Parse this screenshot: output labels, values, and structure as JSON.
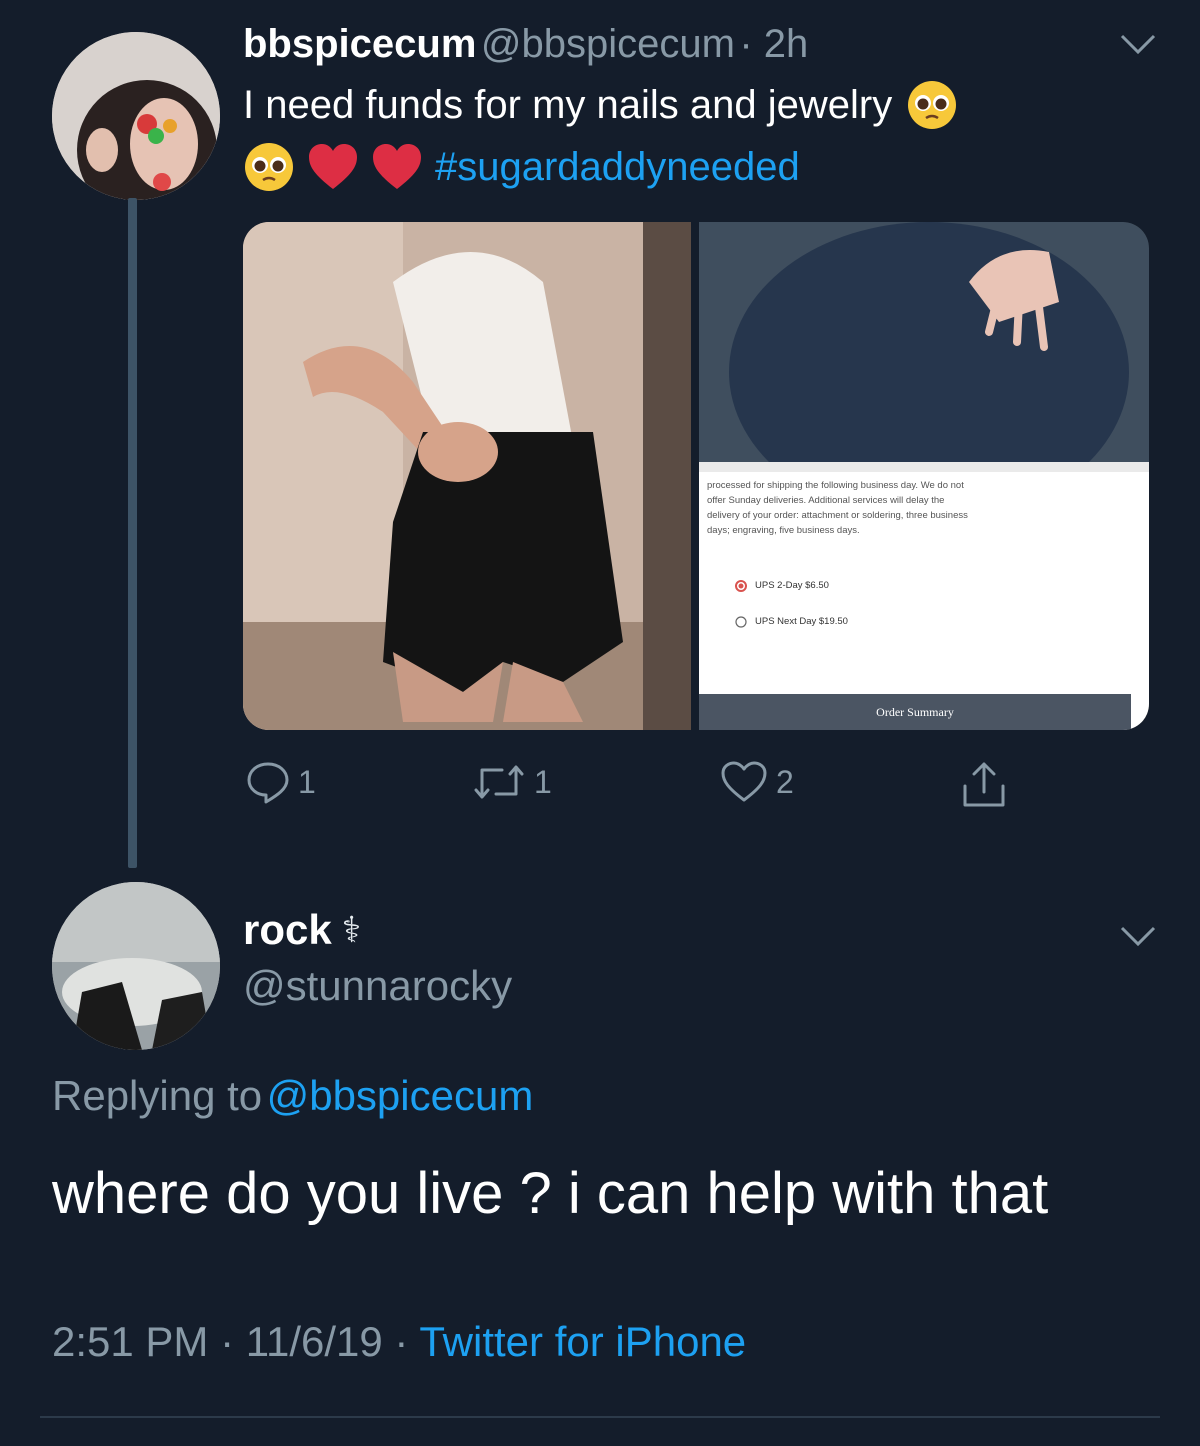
{
  "tweet": {
    "display_name": "bbspicecum",
    "handle": "@bbspicecum",
    "age": "· 2h",
    "text_line1": "I need funds for my nails and jewelry",
    "hashtag": "#sugardaddyneeded",
    "emoji": [
      "pleading-face",
      "red-heart",
      "red-heart"
    ],
    "media": {
      "screenshot_text": [
        "processed for shipping the following business day. We do not",
        "offer Sunday deliveries. Additional services will delay the",
        "delivery of your order: attachment or soldering, three business",
        "days; engraving, five business days."
      ],
      "shipping_options": [
        {
          "label": "UPS 2-Day $6.50",
          "selected": true
        },
        {
          "label": "UPS Next Day $19.50",
          "selected": false
        }
      ],
      "order_summary": "Order Summary"
    },
    "actions": {
      "reply_count": "1",
      "retweet_count": "1",
      "like_count": "2"
    }
  },
  "reply": {
    "display_name": "rock",
    "name_symbol": "⚕",
    "handle": "@stunnarocky",
    "replying_prefix": "Replying to",
    "replying_handle": "@bbspicecum",
    "text": "where do you live ? i can help with that",
    "time": "2:51 PM",
    "separator1": " · ",
    "date": "11/6/19",
    "separator2": " · ",
    "source": "Twitter for iPhone"
  },
  "colors": {
    "background": "#141d2b",
    "link": "#1da1f2",
    "secondary": "#8899a6"
  }
}
